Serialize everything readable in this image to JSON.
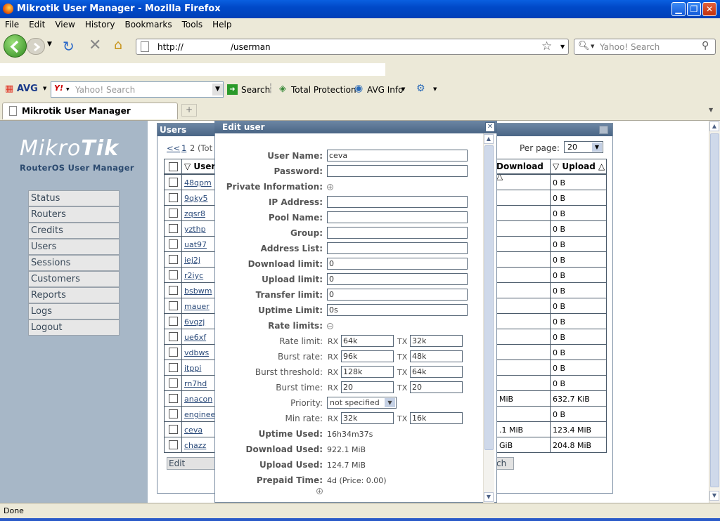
{
  "window": {
    "title": "Mikrotik User Manager - Mozilla Firefox"
  },
  "menu": [
    "File",
    "Edit",
    "View",
    "History",
    "Bookmarks",
    "Tools",
    "Help"
  ],
  "nav": {
    "url_prefix": "http://",
    "url_path": "/userman",
    "search_placeholder": "Yahoo! Search"
  },
  "avg": {
    "brand": "AVG",
    "search_placeholder": "Yahoo! Search",
    "search_label": "Search",
    "protection_label": "Total Protection",
    "info_label": "AVG Info"
  },
  "tab": {
    "label": "Mikrotik User Manager"
  },
  "logo": {
    "name_light": "Mikro",
    "name_bold": "Tik",
    "subtitle": "RouterOS User Manager"
  },
  "sidebar": [
    "Status",
    "Routers",
    "Credits",
    "Users",
    "Sessions",
    "Customers",
    "Reports",
    "Logs",
    "Logout"
  ],
  "users": {
    "title": "Users",
    "pager_prev": "<<",
    "page1": "1",
    "page_text": "2 (Tot",
    "per_page_label": "Per page:",
    "per_page_value": "20",
    "col_user": "▽ User",
    "col_download": "Download △",
    "col_upload": "▽ Upload △",
    "rows": [
      {
        "name": "48qpm",
        "download": "",
        "upload": "0 B"
      },
      {
        "name": "9qky5",
        "download": "",
        "upload": "0 B"
      },
      {
        "name": "zqsr8",
        "download": "",
        "upload": "0 B"
      },
      {
        "name": "yzthp",
        "download": "",
        "upload": "0 B"
      },
      {
        "name": "uat97",
        "download": "",
        "upload": "0 B"
      },
      {
        "name": "iej2j",
        "download": "",
        "upload": "0 B"
      },
      {
        "name": "r2iyc",
        "download": "",
        "upload": "0 B"
      },
      {
        "name": "bsbwm",
        "download": "",
        "upload": "0 B"
      },
      {
        "name": "mauer",
        "download": "",
        "upload": "0 B"
      },
      {
        "name": "6vqzj",
        "download": "",
        "upload": "0 B"
      },
      {
        "name": "ue6xf",
        "download": "",
        "upload": "0 B"
      },
      {
        "name": "vdbws",
        "download": "",
        "upload": "0 B"
      },
      {
        "name": "jtppi",
        "download": "",
        "upload": "0 B"
      },
      {
        "name": "rn7hd",
        "download": "",
        "upload": "0 B"
      },
      {
        "name": "anacon",
        "download": "MiB",
        "upload": "632.7 KiB"
      },
      {
        "name": "enginee",
        "download": "",
        "upload": "0 B"
      },
      {
        "name": "ceva",
        "download": ".1 MiB",
        "upload": "123.4 MiB"
      },
      {
        "name": "chazz",
        "download": "GiB",
        "upload": "204.8 MiB"
      }
    ],
    "edit_button": "Edit",
    "right_button": "ch"
  },
  "edit": {
    "title": "Edit user",
    "fields": [
      {
        "label": "User Name:",
        "value": "ceva"
      },
      {
        "label": "Password:",
        "value": ""
      },
      {
        "label": "Private Information:",
        "value": null
      },
      {
        "label": "IP Address:",
        "value": ""
      },
      {
        "label": "Pool Name:",
        "value": ""
      },
      {
        "label": "Group:",
        "value": ""
      },
      {
        "label": "Address List:",
        "value": ""
      },
      {
        "label": "Download limit:",
        "value": "0"
      },
      {
        "label": "Upload limit:",
        "value": "0"
      },
      {
        "label": "Transfer limit:",
        "value": "0"
      },
      {
        "label": "Uptime Limit:",
        "value": "0s"
      },
      {
        "label": "Rate limits:",
        "value": null
      }
    ],
    "rates": [
      {
        "label": "Rate limit:",
        "rx": "64k",
        "tx": "32k"
      },
      {
        "label": "Burst rate:",
        "rx": "96k",
        "tx": "48k"
      },
      {
        "label": "Burst threshold:",
        "rx": "128k",
        "tx": "64k"
      },
      {
        "label": "Burst time:",
        "rx": "20",
        "tx": "20"
      }
    ],
    "priority_label": "Priority:",
    "priority_value": "not specified",
    "min_rate": {
      "label": "Min rate:",
      "rx": "32k",
      "tx": "16k"
    },
    "rx": "RX",
    "tx": "TX",
    "stats": [
      {
        "label": "Uptime Used:",
        "value": "16h34m37s"
      },
      {
        "label": "Download Used:",
        "value": "922.1 MiB"
      },
      {
        "label": "Upload Used:",
        "value": "124.7 MiB"
      },
      {
        "label": "Prepaid Time:",
        "value": "4d (Price: 0.00)"
      }
    ]
  },
  "status": {
    "text": "Done"
  },
  "colors": {
    "title_bar": "#0049c8",
    "sidebar_bg": "#a7b7c7",
    "window_title": "#4a6585"
  }
}
